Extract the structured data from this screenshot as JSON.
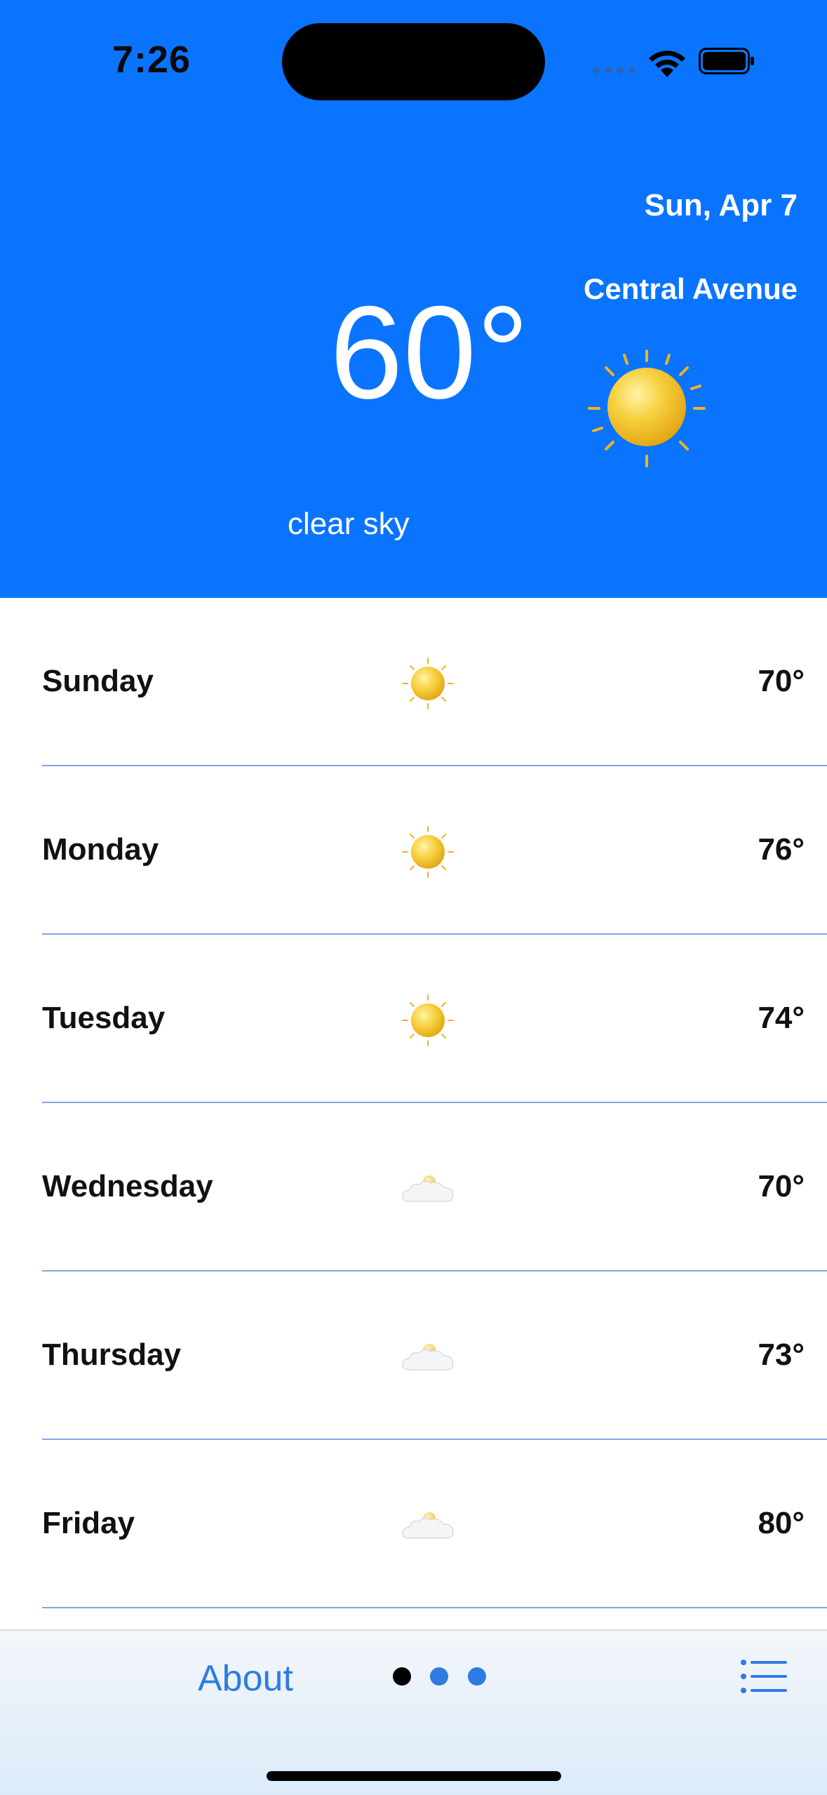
{
  "status_bar": {
    "time": "7:26"
  },
  "header": {
    "date": "Sun, Apr 7",
    "location": "Central Avenue",
    "temperature": "60°",
    "description": "clear sky",
    "icon": "sun-icon",
    "background": "#0a74ff"
  },
  "forecast": [
    {
      "day": "Sunday",
      "icon": "sun-icon",
      "temp": "70°"
    },
    {
      "day": "Monday",
      "icon": "sun-icon",
      "temp": "76°"
    },
    {
      "day": "Tuesday",
      "icon": "sun-icon",
      "temp": "74°"
    },
    {
      "day": "Wednesday",
      "icon": "cloud-sun-icon",
      "temp": "70°"
    },
    {
      "day": "Thursday",
      "icon": "cloud-sun-icon",
      "temp": "73°"
    },
    {
      "day": "Friday",
      "icon": "cloud-sun-icon",
      "temp": "80°"
    }
  ],
  "tab_bar": {
    "about_label": "About",
    "page_count": 3,
    "current_page": 1,
    "accent": "#2e7be4",
    "menu_icon": "list-icon"
  }
}
